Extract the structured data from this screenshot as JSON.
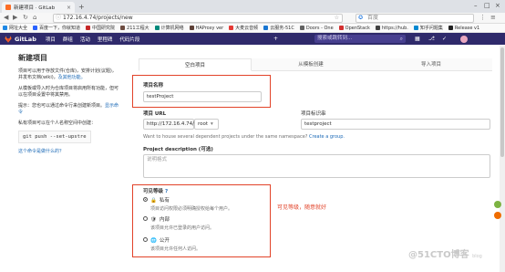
{
  "browser": {
    "tab_title": "新建项目 · GitLab",
    "tab_close": "×",
    "new_tab": "+",
    "url": "172.16.4.74/projects/new",
    "search_engine": "百度",
    "win_min": "–",
    "win_max": "□",
    "win_close": "×"
  },
  "bookmarks": [
    {
      "label": "网址大全",
      "color": "#1e88e5"
    },
    {
      "label": "百度一下，你就知道",
      "color": "#2962ff"
    },
    {
      "label": "中国研究院",
      "color": "#c62828"
    },
    {
      "label": "211工程大",
      "color": "#6d4c41"
    },
    {
      "label": "计算机网络",
      "color": "#00897b"
    },
    {
      "label": "HAProxy ver",
      "color": "#5d4037"
    },
    {
      "label": "大麦云音频",
      "color": "#e53935"
    },
    {
      "label": "云服务-51C",
      "color": "#1976d2"
    },
    {
      "label": "Doors - One",
      "color": "#616161"
    },
    {
      "label": "OpenStack",
      "color": "#d32f2f"
    },
    {
      "label": "https://hub.",
      "color": "#424242"
    },
    {
      "label": "知乎问题集",
      "color": "#0288d1"
    },
    {
      "label": "Release v1",
      "color": "#212121"
    }
  ],
  "gitlab_nav": {
    "brand": "GitLab",
    "links": [
      "项目",
      "群组",
      "活动",
      "里程碑",
      "代码片段"
    ],
    "search_placeholder": "搜索或跳转到...",
    "plus": "+",
    "icons": [
      "▦",
      "✎",
      "⎇",
      "✓"
    ]
  },
  "left": {
    "title": "新建项目",
    "p1": "项目可以用于存放文件(仓库)，安排计划(议题)，并发布文档(wiki)，",
    "p1_link": "及其他功能。",
    "p2": "从模板或导入时为仓库项目将启用所有功能，但可以在项目设置中将其禁用。",
    "p3": "提示：您也可以通过命令行来创建新项目。",
    "p3_link": "显示命令",
    "p4": "私有项目可以在个人名称空间中创建：",
    "code": "git push --set-upstre",
    "p5_link": "这个命令是做什么的？"
  },
  "tabs": [
    "空白项目",
    "从模板创建",
    "导入项目"
  ],
  "form": {
    "project_name_label": "项目名称",
    "project_name_value": "testProject",
    "project_url_label": "项目 URL",
    "project_url_prefix": "http://172.16.4.74/",
    "namespace_value": "root",
    "slug_label": "项目标识串",
    "slug_value": "testproject",
    "namespace_hint": "Want to house several dependent projects under the same namespace?",
    "namespace_hint_link": "Create a group.",
    "desc_label": "Project description (可选)",
    "desc_placeholder": "说明格式",
    "visibility_label": "可见等级",
    "visibility_help": "?",
    "options": [
      {
        "title": "私有",
        "icon": "🔒",
        "desc": "项目访问权限必须明确授权给每个用户。",
        "checked": true
      },
      {
        "title": "内部",
        "icon": "🛡",
        "desc": "该项目允许已登录的用户访问。",
        "checked": false
      },
      {
        "title": "公开",
        "icon": "🌐",
        "desc": "该项目允许任何人访问。",
        "checked": false
      }
    ]
  },
  "annotation": "可见等级，随意就好",
  "watermark": "@51CTO博客",
  "watermark_sub": "blog"
}
